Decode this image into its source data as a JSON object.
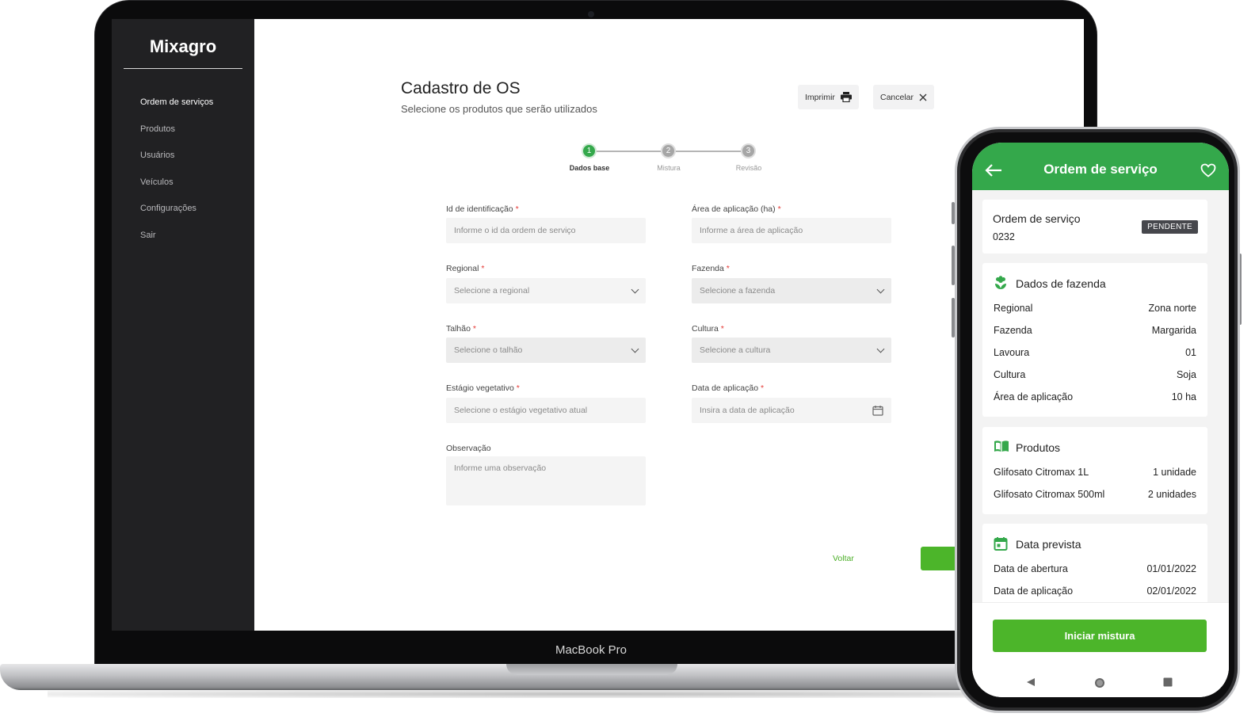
{
  "laptop": {
    "label": "MacBook Pro",
    "sidebar": {
      "brand": "Mixagro",
      "items": [
        {
          "label": "Ordem de serviços",
          "active": true
        },
        {
          "label": "Produtos"
        },
        {
          "label": "Usuários"
        },
        {
          "label": "Veículos"
        },
        {
          "label": "Configurações"
        },
        {
          "label": "Sair"
        }
      ]
    },
    "header": {
      "title": "Cadastro de OS",
      "subtitle": "Selecione os produtos que serão utilizados",
      "print_label": "Imprimir",
      "cancel_label": "Cancelar"
    },
    "stepper": {
      "steps": [
        {
          "number": "1",
          "label": "Dados base",
          "active": true
        },
        {
          "number": "2",
          "label": "Mistura"
        },
        {
          "number": "3",
          "label": "Revisão"
        }
      ]
    },
    "form": {
      "id": {
        "label": "Id de identificação",
        "placeholder": "Informe o id da ordem de serviço"
      },
      "area": {
        "label": "Área de aplicação (ha)",
        "placeholder": "Informe a área de aplicação"
      },
      "regional": {
        "label": "Regional",
        "placeholder": "Selecione a regional"
      },
      "fazenda": {
        "label": "Fazenda",
        "placeholder": "Selecione a fazenda"
      },
      "talhao": {
        "label": "Talhão",
        "placeholder": "Selecione o talhão"
      },
      "cultura": {
        "label": "Cultura",
        "placeholder": "Selecione a cultura"
      },
      "estagio": {
        "label": "Estágio vegetativo",
        "placeholder": "Selecione o estágio vegetativo atual"
      },
      "data": {
        "label": "Data de aplicação",
        "placeholder": "Insira a data de aplicação"
      },
      "obs": {
        "label": "Observação",
        "placeholder": "Informe uma observação"
      },
      "required_mark": "*"
    },
    "actions": {
      "back_label": "Voltar"
    }
  },
  "phone": {
    "header_title": "Ordem de serviço",
    "order": {
      "title": "Ordem de serviço",
      "number": "0232",
      "status": "PENDENTE"
    },
    "farm": {
      "title": "Dados de fazenda",
      "rows": [
        {
          "label": "Regional",
          "value": "Zona norte"
        },
        {
          "label": "Fazenda",
          "value": "Margarida"
        },
        {
          "label": "Lavoura",
          "value": "01"
        },
        {
          "label": "Cultura",
          "value": "Soja"
        },
        {
          "label": "Área de aplicação",
          "value": "10 ha"
        }
      ]
    },
    "products": {
      "title": "Produtos",
      "rows": [
        {
          "label": "Glifosato Citromax 1L",
          "value": "1 unidade"
        },
        {
          "label": "Glifosato Citromax 500ml",
          "value": "2 unidades"
        }
      ]
    },
    "dates": {
      "title": "Data prevista",
      "rows": [
        {
          "label": "Data de abertura",
          "value": "01/01/2022"
        },
        {
          "label": "Data de aplicação",
          "value": "02/01/2022"
        }
      ]
    },
    "start_button": "Iniciar mistura"
  },
  "colors": {
    "accent": "#34a84b",
    "button_green": "#4cb52a",
    "sidebar": "#212123"
  }
}
